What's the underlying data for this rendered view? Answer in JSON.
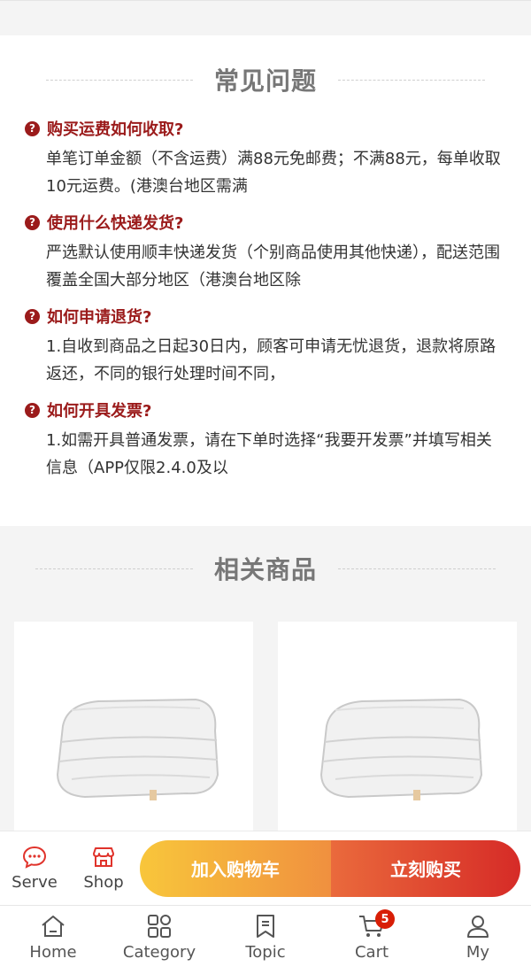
{
  "faq": {
    "title": "常见问题",
    "items": [
      {
        "q": "购买运费如何收取?",
        "a": "单笔订单金额（不含运费）满88元免邮费；不满88元，每单收取10元运费。(港澳台地区需满"
      },
      {
        "q": "使用什么快递发货?",
        "a": "严选默认使用顺丰快递发货（个别商品使用其他快递），配送范围覆盖全国大部分地区（港澳台地区除"
      },
      {
        "q": "如何申请退货?",
        "a": "1.自收到商品之日起30日内，顾客可申请无忧退货，退款将原路返还，不同的银行处理时间不同，"
      },
      {
        "q": "如何开具发票?",
        "a": "1.如需开具普通发票，请在下单时选择“我要开发票”并填写相关信息（APP仅限2.4.0及以"
      }
    ]
  },
  "related": {
    "title": "相关商品"
  },
  "action_bar": {
    "serve_label": "Serve",
    "shop_label": "Shop",
    "add_cart_label": "加入购物车",
    "buy_now_label": "立刻购买"
  },
  "tabs": {
    "home": "Home",
    "category": "Category",
    "topic": "Topic",
    "cart": "Cart",
    "cart_badge": "5",
    "my": "My"
  }
}
